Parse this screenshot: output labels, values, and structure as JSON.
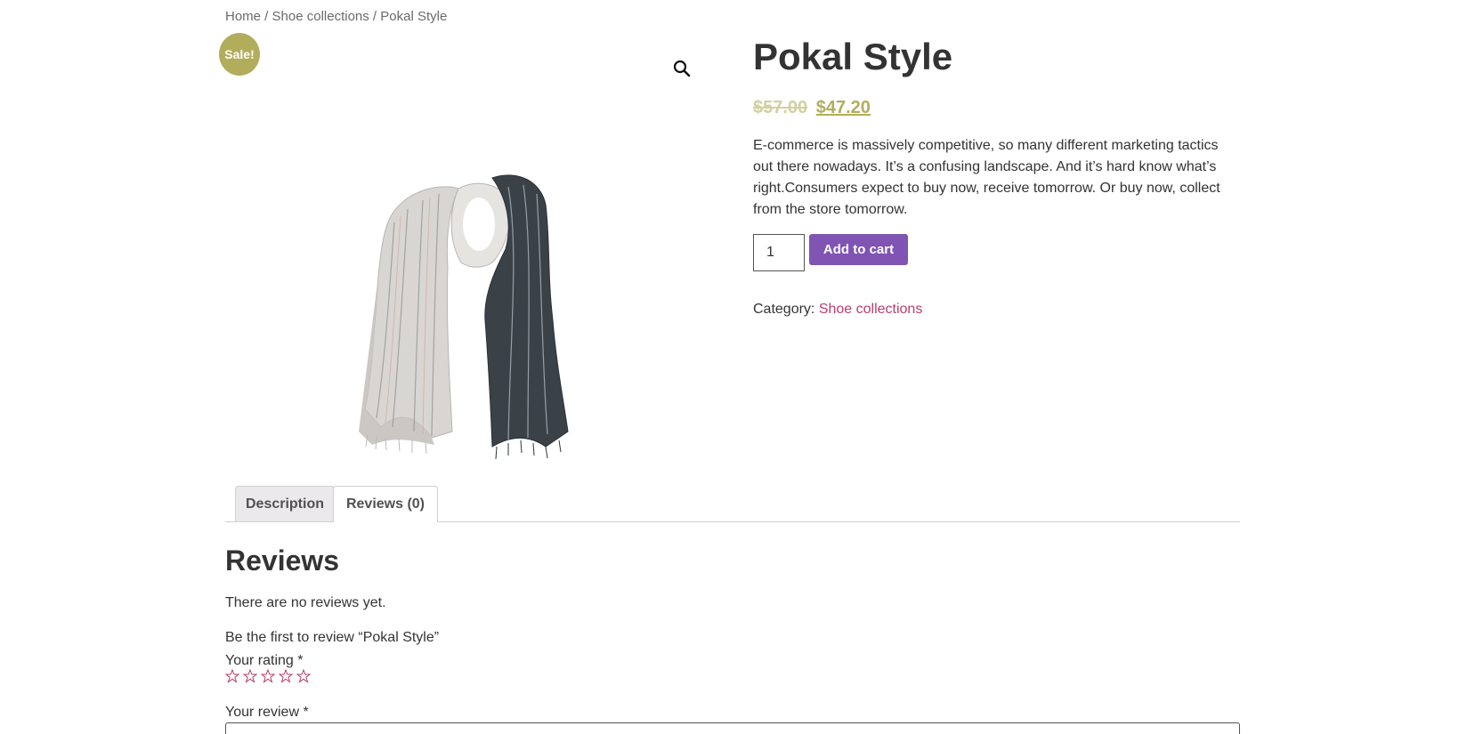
{
  "breadcrumb": {
    "home": "Home",
    "separator1": " / ",
    "collection": "Shoe collections",
    "separator2": " / ",
    "current": "Pokal Style"
  },
  "product": {
    "sale_badge": "Sale!",
    "title": "Pokal Style",
    "old_price": "$57.00",
    "new_price": "$47.20",
    "description": "E-commerce is massively competitive, so many different marketing tactics out there nowadays. It’s a confusing landscape. And it’s hard know what’s right.Consumers expect to buy now, receive tomorrow. Or buy now, collect from the store tomorrow.",
    "quantity": "1",
    "add_to_cart_label": "Add to cart",
    "category_label": "Category: ",
    "category_link": "Shoe collections",
    "zoom_icon": "search-icon"
  },
  "tabs": [
    {
      "label": "Description"
    },
    {
      "label": "Reviews (0)"
    }
  ],
  "reviews": {
    "title": "Reviews",
    "empty_text": "There are no reviews yet.",
    "be_first": "Be the first to review “Pokal Style”",
    "rating_label": "Your rating *",
    "review_label": "Your review *",
    "stars": 5
  },
  "colors": {
    "accent_olive": "#b2ad5b",
    "button_purple": "#7f54b3",
    "link_pink": "#b83f6c"
  }
}
